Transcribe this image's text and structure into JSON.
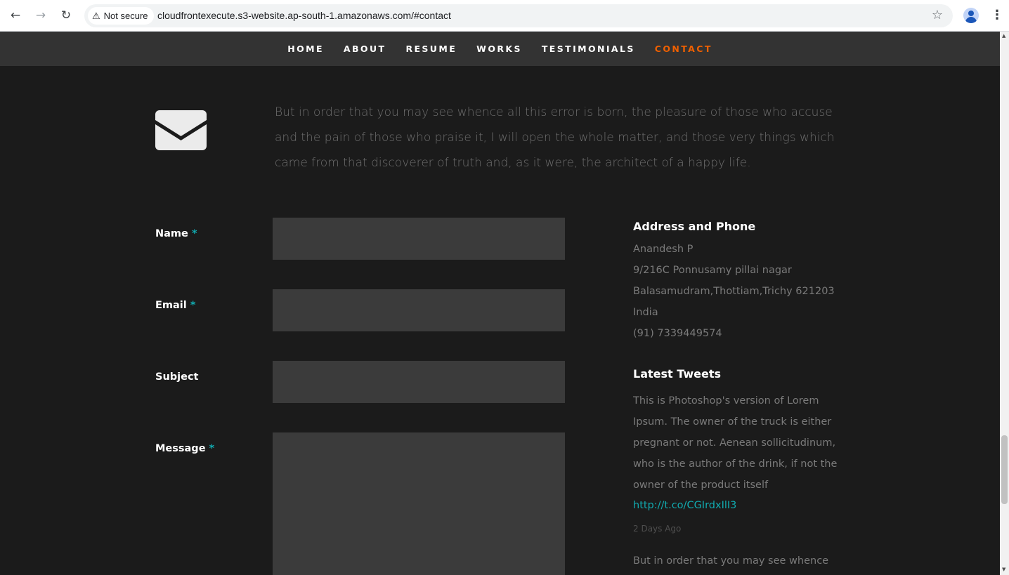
{
  "browser": {
    "security_label": "Not secure",
    "url": "cloudfrontexecute.s3-website.ap-south-1.amazonaws.com/#contact"
  },
  "nav": {
    "items": [
      {
        "label": "HOME"
      },
      {
        "label": "ABOUT"
      },
      {
        "label": "RESUME"
      },
      {
        "label": "WORKS"
      },
      {
        "label": "TESTIMONIALS"
      },
      {
        "label": "CONTACT",
        "active": true
      }
    ],
    "active_color": "#f06000"
  },
  "contact": {
    "lead": "But in order that you may see whence all this error is born, the pleasure of those who accuse and the pain of those who praise it, I will open the whole matter, and those very things which came from that discoverer of truth and, as it were, the architect of a happy life.",
    "form": {
      "name_label": "Name",
      "email_label": "Email",
      "subject_label": "Subject",
      "message_label": "Message",
      "required_mark": "*",
      "name_value": "",
      "email_value": "",
      "subject_value": "",
      "message_value": ""
    },
    "address": {
      "heading": "Address and Phone",
      "name": "Anandesh P",
      "street": "9/216C Ponnusamy pillai nagar",
      "city": "Balasamudram,Thottiam,Trichy 621203",
      "country": "India",
      "phone": "(91) 7339449574"
    },
    "tweets": {
      "heading": "Latest Tweets",
      "items": [
        {
          "text": "This is Photoshop's version of Lorem Ipsum. The owner of the truck is either pregnant or not. Aenean sollicitudinum, who is the author of the drink, if not the owner of the product itself",
          "link": "http://t.co/CGIrdxIlI3",
          "time": "2 Days Ago"
        },
        {
          "text": "But in order that you may see whence all"
        }
      ]
    }
  },
  "colors": {
    "accent": "#11abb0",
    "background": "#1b1b1b",
    "field": "#3b3b3b",
    "nav_background": "#333333"
  }
}
